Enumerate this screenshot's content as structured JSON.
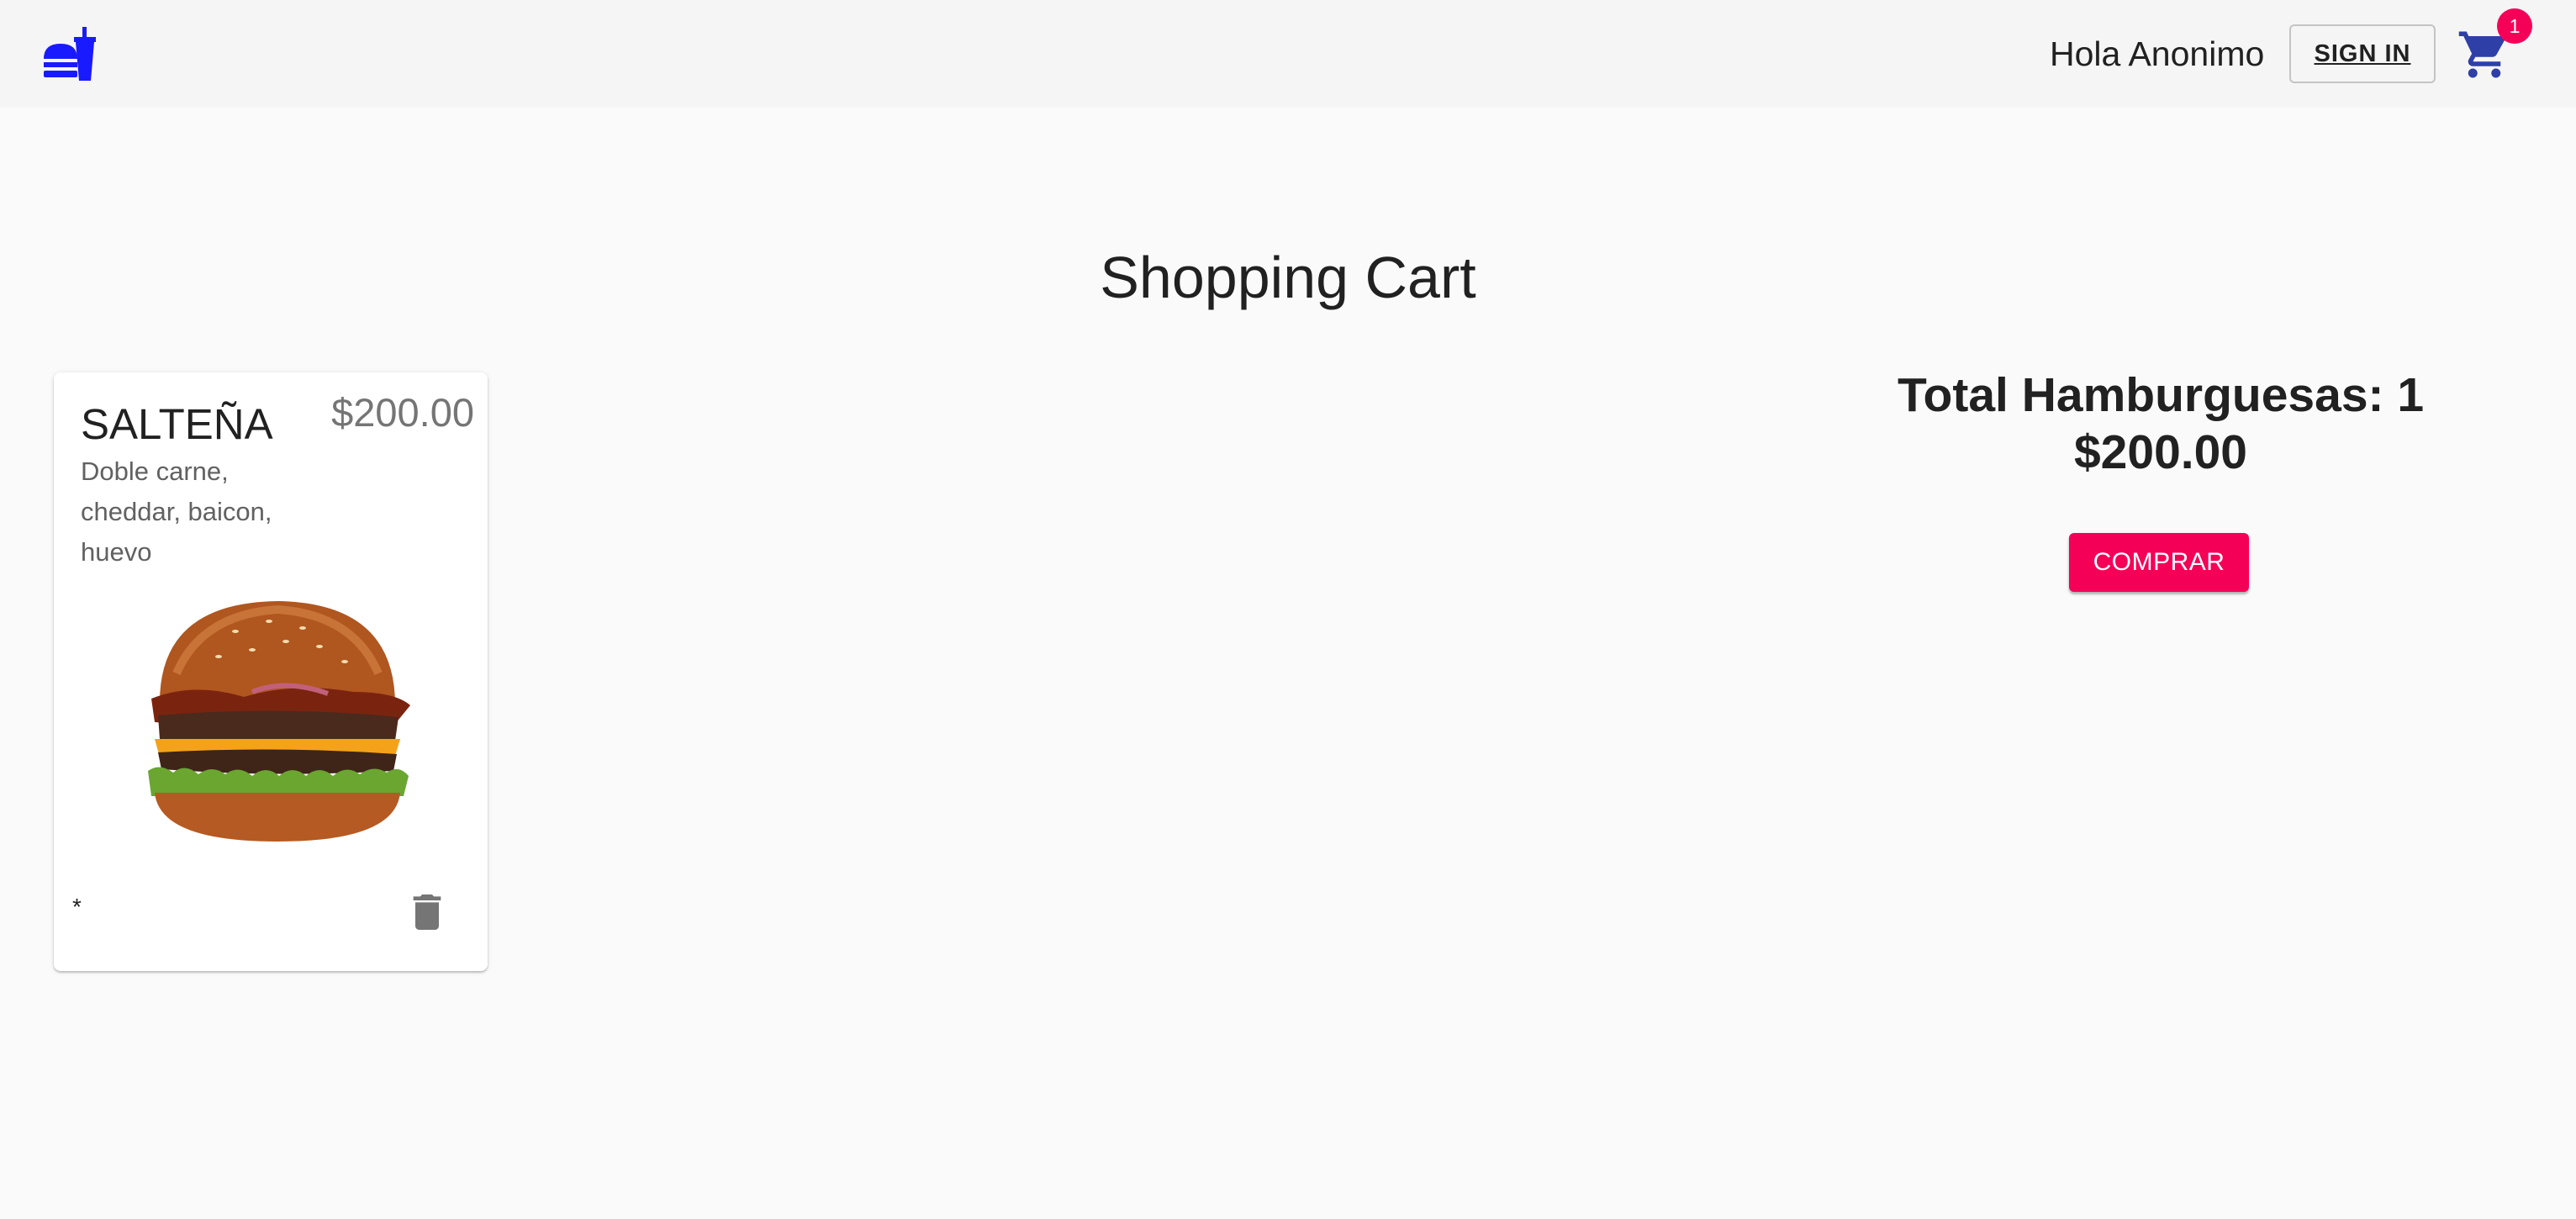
{
  "header": {
    "logo_icon": "fastfood-icon",
    "greeting": "Hola Anonimo",
    "signin_label": "SIGN IN",
    "cart_icon": "shopping-cart-icon",
    "cart_badge": "1",
    "accent_color": "#1a1aff",
    "badge_color": "#f50057"
  },
  "main": {
    "title": "Shopping Cart"
  },
  "cart_items": [
    {
      "name": "SALTEÑA",
      "price": "$200.00",
      "description": "Doble carne, cheddar, baicon, huevo",
      "image_icon": "hamburger-image",
      "quantity_marker": "*",
      "delete_icon": "trash-icon"
    }
  ],
  "summary": {
    "total_label": "Total Hamburguesas: 1",
    "total_price": "$200.00",
    "buy_label": "COMPRAR",
    "buy_color": "#f50057"
  }
}
